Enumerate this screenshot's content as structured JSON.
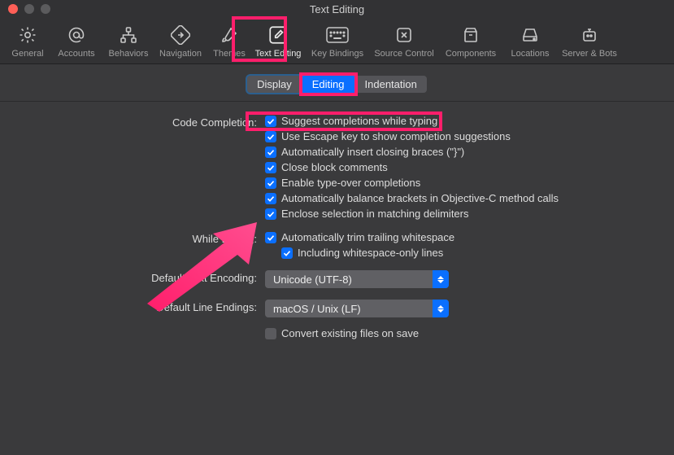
{
  "window": {
    "title": "Text Editing"
  },
  "toolbar": {
    "items": [
      {
        "label": "General"
      },
      {
        "label": "Accounts"
      },
      {
        "label": "Behaviors"
      },
      {
        "label": "Navigation"
      },
      {
        "label": "Themes"
      },
      {
        "label": "Text Editing"
      },
      {
        "label": "Key Bindings"
      },
      {
        "label": "Source Control"
      },
      {
        "label": "Components"
      },
      {
        "label": "Locations"
      },
      {
        "label": "Server & Bots"
      }
    ]
  },
  "tabs": {
    "display": "Display",
    "editing": "Editing",
    "indentation": "Indentation"
  },
  "sections": {
    "code_completion": {
      "label": "Code Completion:",
      "opts": [
        "Suggest completions while typing",
        "Use Escape key to show completion suggestions",
        "Automatically insert closing braces (\"}\")",
        "Close block comments",
        "Enable type-over completions",
        "Automatically balance brackets in Objective-C method calls",
        "Enclose selection in matching delimiters"
      ]
    },
    "while_editing": {
      "label": "While Editing:",
      "opt1": "Automatically trim trailing whitespace",
      "opt2": "Including whitespace-only lines"
    },
    "encoding": {
      "label": "Default Text Encoding:",
      "value": "Unicode (UTF-8)"
    },
    "line_endings": {
      "label": "Default Line Endings:",
      "value": "macOS / Unix (LF)",
      "convert": "Convert existing files on save"
    }
  }
}
